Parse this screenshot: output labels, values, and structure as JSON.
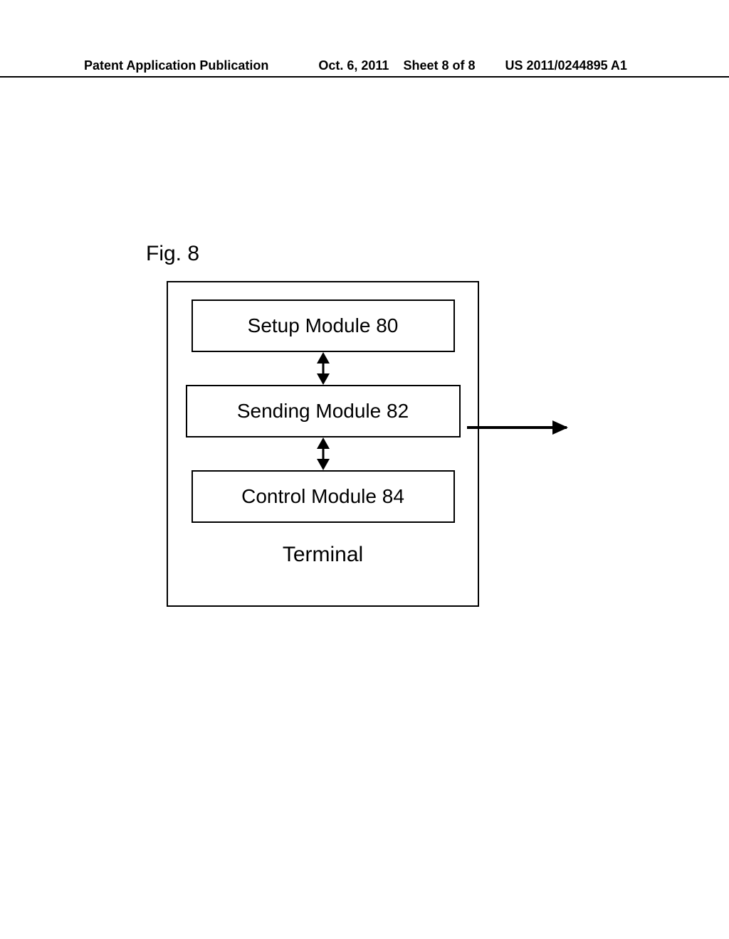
{
  "header": {
    "pub_type": "Patent Application Publication",
    "date": "Oct. 6, 2011",
    "sheet": "Sheet 8 of 8",
    "pub_num": "US 2011/0244895 A1"
  },
  "figure": {
    "label": "Fig. 8",
    "modules": {
      "setup": "Setup Module 80",
      "sending": "Sending Module 82",
      "control": "Control Module 84"
    },
    "container_label": "Terminal"
  }
}
